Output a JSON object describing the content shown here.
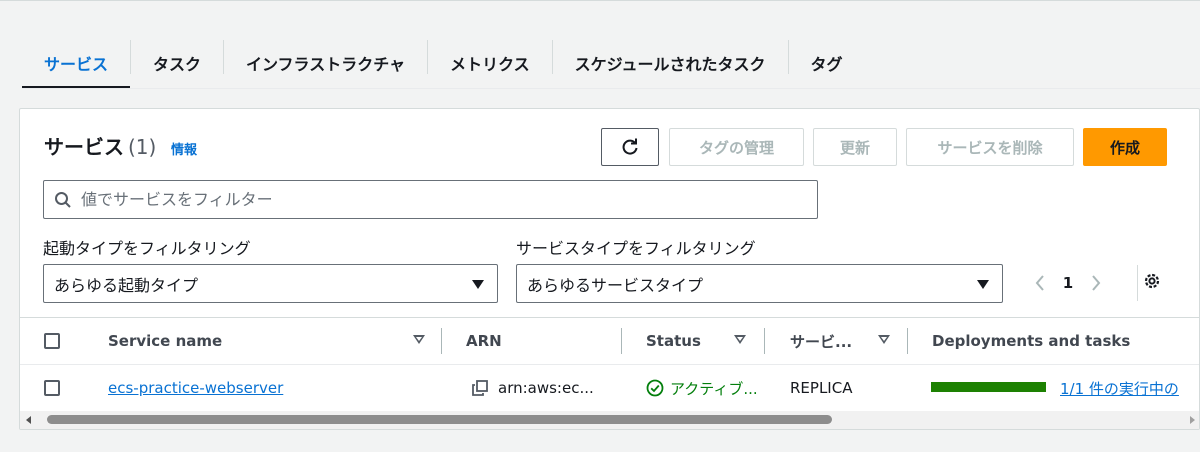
{
  "tabs": [
    {
      "label": "サービス",
      "active": true
    },
    {
      "label": "タスク"
    },
    {
      "label": "インフラストラクチャ"
    },
    {
      "label": "メトリクス"
    },
    {
      "label": "スケジュールされたタスク"
    },
    {
      "label": "タグ"
    }
  ],
  "panel": {
    "title": "サービス",
    "count": "(1)",
    "info_link": "情報"
  },
  "actions": {
    "tags": "タグの管理",
    "update": "更新",
    "delete": "サービスを削除",
    "create": "作成"
  },
  "search": {
    "placeholder": "値でサービスをフィルター"
  },
  "filters": {
    "launch_label": "起動タイプをフィルタリング",
    "launch_value": "あらゆる起動タイプ",
    "service_label": "サービスタイプをフィルタリング",
    "service_value": "あらゆるサービスタイプ"
  },
  "pagination": {
    "page": "1"
  },
  "table": {
    "headers": {
      "name": "Service name",
      "arn": "ARN",
      "status": "Status",
      "service_type": "サービ...",
      "deployments": "Deployments and tasks"
    },
    "rows": [
      {
        "name": "ecs-practice-webserver",
        "arn": "arn:aws:ec...",
        "status": "アクティブ...",
        "service_type": "REPLICA",
        "tasks": "1/1 件の実行中の",
        "progress": 1.0
      }
    ]
  },
  "colors": {
    "accent": "#0972d3",
    "primary_button": "#ff9900",
    "success": "#037f0c",
    "progress": "#1d8102"
  }
}
